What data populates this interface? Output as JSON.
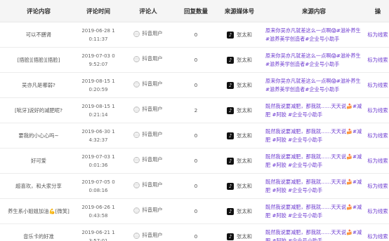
{
  "headers": [
    "评论内容",
    "评论时间",
    "评论人",
    "回复数量",
    "来源媒体号",
    "来源内容",
    "操"
  ],
  "rows": [
    {
      "text": "可以不膳肾",
      "date": "2019-06-28 1",
      "time": "0:11:37",
      "user": "抖音用户",
      "replies": "0",
      "media": "张太和",
      "source": "原来你吴亦凡就差这么一点啊😱#滋补养生#滋养美学创造者#企业号小助手",
      "action": "标为线索"
    },
    {
      "text": "[捂脸][捂脸][捂脸]",
      "date": "2019-07-03 0",
      "time": "9:52:07",
      "user": "抖音用户",
      "replies": "0",
      "media": "张太和",
      "source": "原来你吴亦凡就差这么一点啊😱#滋补养生#滋养美学创造者#企业号小助手",
      "action": "标为线索"
    },
    {
      "text": "吴亦凡是哪弱?",
      "date": "2019-08-15 1",
      "time": "0:20:59",
      "user": "抖音用户",
      "replies": "0",
      "media": "张太和",
      "source": "原来你吴亦凡就差这么一点啊😱#滋补养生#滋养美学创造者#企业号小助手",
      "action": "标为线索"
    },
    {
      "text": "[呲牙]说好的减肥呢?",
      "date": "2019-08-15 1",
      "time": "0:21:14",
      "user": "抖音用户",
      "replies": "2",
      "media": "张太和",
      "source": "既然我说要减肥，那我就……天天说🍰#减肥 #阿胶 #企业号小助手",
      "action": "标为线索"
    },
    {
      "text": "要我的小心心吗~",
      "date": "2019-06-30 1",
      "time": "4:32:37",
      "user": "抖音用户",
      "replies": "0",
      "media": "张太和",
      "source": "既然我说要减肥，那我就……天天说🍰#减肥 #阿胶 #企业号小助手",
      "action": "标为线索"
    },
    {
      "text": "好可爱",
      "date": "2019-07-03 1",
      "time": "0:01:36",
      "user": "抖音用户",
      "replies": "0",
      "media": "张太和",
      "source": "既然我说要减肥，那我就……天天说🍰#减肥 #阿胶 #企业号小助手",
      "action": "标为线索"
    },
    {
      "text": "超喜欢，和大家分享",
      "date": "2019-07-05 0",
      "time": "0:08:16",
      "user": "抖音用户",
      "replies": "0",
      "media": "张太和",
      "source": "既然我说要减肥，那我就……天天说🍰#减肥 #阿胶 #企业号小助手",
      "action": "标为线索"
    },
    {
      "text": "养生系小姐姐加油💪[微笑]",
      "date": "2019-06-26 1",
      "time": "0:43:58",
      "user": "抖音用户",
      "replies": "0",
      "media": "张太和",
      "source": "既然我说要减肥，那我就……天天说🍰#减肥 #阿胶 #企业号小助手",
      "action": "标为线索"
    },
    {
      "text": "音乐卡的好准",
      "date": "2019-06-21 1",
      "time": "3:57:01",
      "user": "抖音用户",
      "replies": "0",
      "media": "张太和",
      "source": "既然我说要减肥，那我就……天天说🍰#减肥 #阿胶 #企业号小助手",
      "action": "标为线索"
    }
  ]
}
